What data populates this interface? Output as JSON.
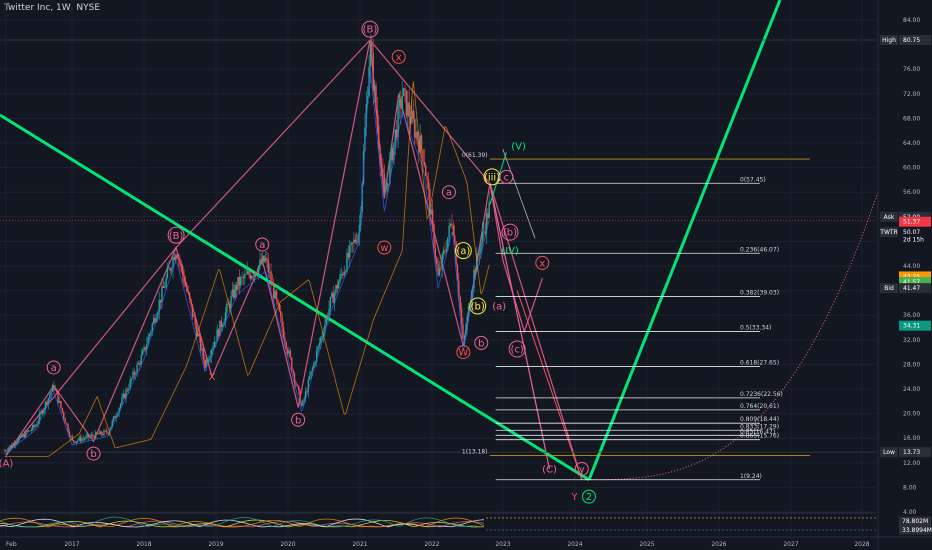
{
  "header": {
    "title": "Twitter Inc, 1W, NYSE"
  },
  "chart_data": {
    "type": "line",
    "title": "Twitter Inc, 1W, NYSE",
    "x_ticks": [
      "Feb",
      "2017",
      "2018",
      "2019",
      "2020",
      "2021",
      "2022",
      "2023",
      "2024",
      "2025",
      "2026",
      "2027",
      "2028"
    ],
    "y_ticks": [
      4.0,
      8.0,
      12.0,
      16.0,
      20.0,
      24.0,
      28.0,
      32.0,
      36.0,
      40.0,
      44.0,
      48.0,
      52.0,
      56.0,
      60.0,
      64.0,
      68.0,
      72.0,
      76.0,
      84.0
    ],
    "price_path": [
      {
        "x": 2016.08,
        "y": 14.0
      },
      {
        "x": 2016.5,
        "y": 18.0
      },
      {
        "x": 2016.75,
        "y": 24.5
      },
      {
        "x": 2017.0,
        "y": 15.5
      },
      {
        "x": 2017.5,
        "y": 17.0
      },
      {
        "x": 2018.0,
        "y": 30.0
      },
      {
        "x": 2018.45,
        "y": 47.0
      },
      {
        "x": 2018.85,
        "y": 28.0
      },
      {
        "x": 2019.3,
        "y": 41.0
      },
      {
        "x": 2019.7,
        "y": 45.0
      },
      {
        "x": 2020.2,
        "y": 21.0
      },
      {
        "x": 2020.6,
        "y": 38.0
      },
      {
        "x": 2021.0,
        "y": 50.0
      },
      {
        "x": 2021.15,
        "y": 80.0
      },
      {
        "x": 2021.35,
        "y": 55.0
      },
      {
        "x": 2021.6,
        "y": 72.0
      },
      {
        "x": 2021.9,
        "y": 62.0
      },
      {
        "x": 2022.1,
        "y": 42.0
      },
      {
        "x": 2022.3,
        "y": 52.0
      },
      {
        "x": 2022.45,
        "y": 31.0
      },
      {
        "x": 2022.6,
        "y": 43.0
      },
      {
        "x": 2022.82,
        "y": 54.0
      }
    ],
    "series": [
      {
        "name": "High",
        "values": [
          80.75
        ]
      },
      {
        "name": "Low",
        "values": [
          13.73
        ]
      }
    ],
    "fib_levels": [
      {
        "label": "0(61.39)",
        "value": 61.39
      },
      {
        "label": "0(57.45)",
        "value": 57.45
      },
      {
        "label": "0.236(46.07)",
        "value": 46.07
      },
      {
        "label": "0.382(39.03)",
        "value": 39.03
      },
      {
        "label": "0.5(33.34)",
        "value": 33.34
      },
      {
        "label": "0.618(27.65)",
        "value": 27.65
      },
      {
        "label": "0.7236(22.56)",
        "value": 22.56
      },
      {
        "label": "0.764(20.61)",
        "value": 20.61
      },
      {
        "label": "0.809(18.44)",
        "value": 18.44
      },
      {
        "label": "0.833(17.29)",
        "value": 17.29
      },
      {
        "label": "0.85(16.47)",
        "value": 16.47
      },
      {
        "label": "0.865(15.76)",
        "value": 15.76
      },
      {
        "label": "1(13.18)",
        "value": 13.18
      },
      {
        "label": "1(9.24)",
        "value": 9.24
      }
    ],
    "wave_labels": [
      {
        "text": "(A)",
        "x": 2016.1,
        "y": 12.0,
        "color": "#f06292",
        "circled": false
      },
      {
        "text": "a",
        "x": 2016.75,
        "y": 27.5,
        "color": "#f06292",
        "circled": true
      },
      {
        "text": "b",
        "x": 2017.3,
        "y": 13.5,
        "color": "#f06292",
        "circled": true
      },
      {
        "text": "(B)",
        "x": 2018.45,
        "y": 49.0,
        "color": "#f06292",
        "circled": true
      },
      {
        "text": "X",
        "x": 2018.95,
        "y": 26.0,
        "color": "#ef5350",
        "circled": false
      },
      {
        "text": "a",
        "x": 2019.65,
        "y": 47.5,
        "color": "#f06292",
        "circled": true
      },
      {
        "text": "b",
        "x": 2020.15,
        "y": 19.0,
        "color": "#f06292",
        "circled": true
      },
      {
        "text": "w",
        "x": 2021.35,
        "y": 47.0,
        "color": "#ef5350",
        "circled": true
      },
      {
        "text": "(B)",
        "x": 2021.15,
        "y": 82.5,
        "color": "#f06292",
        "circled": true
      },
      {
        "text": "x",
        "x": 2021.55,
        "y": 78.0,
        "color": "#ef5350",
        "circled": true
      },
      {
        "text": "a",
        "x": 2022.25,
        "y": 56.0,
        "color": "#f06292",
        "circled": true
      },
      {
        "text": "(a)",
        "x": 2022.45,
        "y": 46.5,
        "color": "#ffeb3b",
        "circled": true
      },
      {
        "text": "W",
        "x": 2022.45,
        "y": 30.0,
        "color": "#ef5350",
        "circled": true
      },
      {
        "text": "(b)",
        "x": 2022.65,
        "y": 37.5,
        "color": "#ffeb3b",
        "circled": true
      },
      {
        "text": "b",
        "x": 2022.7,
        "y": 31.5,
        "color": "#f06292",
        "circled": true
      },
      {
        "text": "(iii)",
        "x": 2022.85,
        "y": 58.5,
        "color": "#ffeb3b",
        "circled": true
      },
      {
        "text": "c",
        "x": 2023.05,
        "y": 58.5,
        "color": "#f06292",
        "circled": true
      },
      {
        "text": "(V)",
        "x": 2023.22,
        "y": 63.5,
        "color": "#00e676",
        "circled": false
      },
      {
        "text": "(IV)",
        "x": 2023.1,
        "y": 46.5,
        "color": "#00e676",
        "circled": false
      },
      {
        "text": "(b)",
        "x": 2023.1,
        "y": 49.5,
        "color": "#f06292",
        "circled": true
      },
      {
        "text": "(a)",
        "x": 2022.95,
        "y": 37.5,
        "color": "#f06292",
        "circled": false
      },
      {
        "text": "(c)",
        "x": 2023.2,
        "y": 30.5,
        "color": "#f06292",
        "circled": true
      },
      {
        "text": "x",
        "x": 2023.55,
        "y": 44.5,
        "color": "#ef5350",
        "circled": true
      },
      {
        "text": "(C)",
        "x": 2023.65,
        "y": 11.0,
        "color": "#f06292",
        "circled": false
      },
      {
        "text": "y",
        "x": 2024.1,
        "y": 11.0,
        "color": "#f06292",
        "circled": true
      },
      {
        "text": "Y",
        "x": 2024.0,
        "y": 6.5,
        "color": "#ef5350",
        "circled": false
      },
      {
        "text": "2",
        "x": 2024.2,
        "y": 6.5,
        "color": "#00e676",
        "circled": true
      }
    ],
    "price_tags": [
      {
        "label": "High",
        "value": "80.75",
        "price": 80.75,
        "bg": "#2a2e39"
      },
      {
        "label": "Ask",
        "value": "52.00",
        "price": 52.0,
        "bg": "#2a2e39"
      },
      {
        "label": "",
        "value": "51.37",
        "price": 51.2,
        "bg": "#f23645"
      },
      {
        "label": "TWTR",
        "value": "50.07",
        "price": 49.5,
        "bg": "#131722"
      },
      {
        "label": "",
        "value": "2d 15h",
        "price": 48.3,
        "bg": "#131722"
      },
      {
        "label": "",
        "value": "43.25",
        "price": 42.3,
        "bg": "#ff9800"
      },
      {
        "label": "",
        "value": "41.57",
        "price": 41.4,
        "bg": "#4caf50"
      },
      {
        "label": "Bid",
        "value": "41.47",
        "price": 40.4,
        "bg": "#2a2e39"
      },
      {
        "label": "",
        "value": "34.31",
        "price": 34.3,
        "bg": "#089981"
      },
      {
        "label": "Low",
        "value": "13.73",
        "price": 13.73,
        "bg": "#2a2e39"
      }
    ],
    "indicator_tags": [
      {
        "value": "78.802M",
        "bg": "#2a2e39"
      },
      {
        "value": "33.8994M",
        "bg": "#2a2e39"
      }
    ],
    "colors": {
      "background": "#131722",
      "up_candle": "#26a69a",
      "down_candle": "#ef5350",
      "wave_pink": "#f06292",
      "trend_green": "#00e676",
      "fib_line": "#ffffff",
      "fib_top": "#d4a017"
    }
  }
}
